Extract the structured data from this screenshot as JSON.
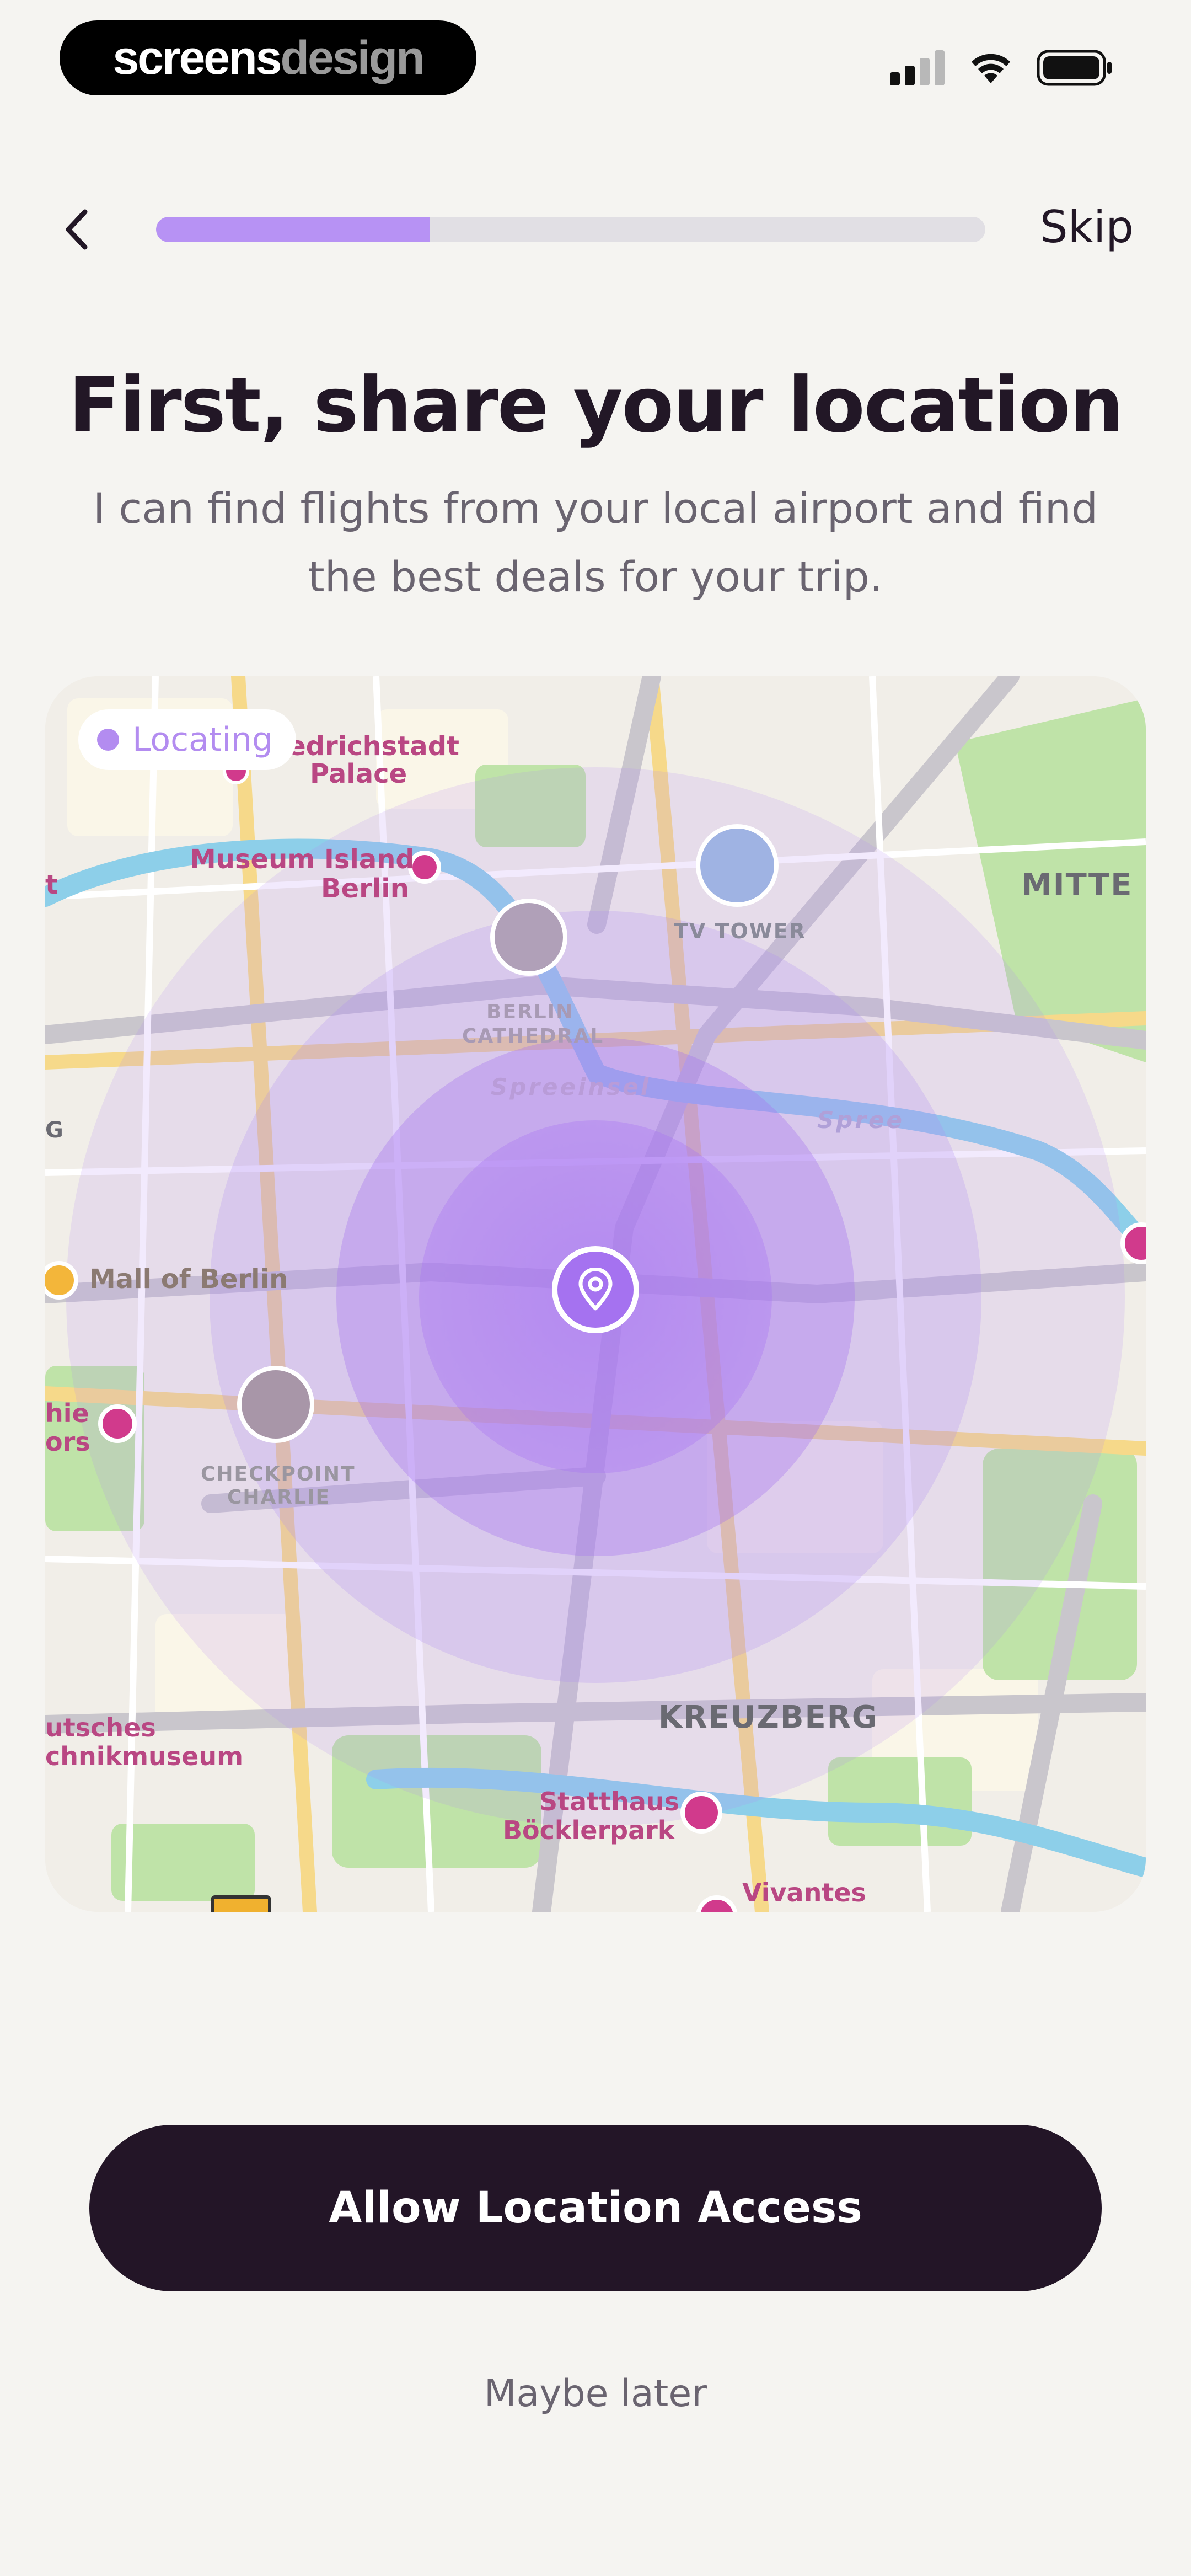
{
  "status_bar": {
    "brand_part1": "screens",
    "brand_part2": "design",
    "signal_icon": "cellular-signal-icon",
    "wifi_icon": "wifi-icon",
    "battery_icon": "battery-icon"
  },
  "nav": {
    "back_icon": "chevron-left-icon",
    "progress_fraction": 0.33,
    "skip_label": "Skip"
  },
  "header": {
    "title": "First, share your location",
    "subtitle": "I can find flights from your local airport and find the best deals for your trip."
  },
  "map": {
    "status_label": "Locating",
    "accent_color": "#a572f0",
    "labels": {
      "friedrichstadt": "riedrichstadt",
      "palace": "Palace",
      "museum_island": "Museum Island",
      "museum_island_2": "Berlin",
      "tv_tower": "TV TOWER",
      "berlin_cathedral": "BERLIN",
      "berlin_cathedral_2": "CATHEDRAL",
      "spreeinsel": "Spreeinsel",
      "spree": "Spree",
      "mitte": "MITTE",
      "mall_of_berlin": "Mall of Berlin",
      "hie": "hie",
      "ors": "ors",
      "checkpoint": "CHECKPOINT",
      "charlie": "CHARLIE",
      "kreuzberg": "KREUZBERG",
      "technikmuseum_1": "utsches",
      "technikmuseum_2": "chnikmuseum",
      "statthaus_1": "Statthaus",
      "statthaus_2": "Böcklerpark",
      "vivantes": "Vivantes",
      "g": "G",
      "t": "t"
    },
    "center_pin_icon": "location-pin-icon"
  },
  "actions": {
    "primary_label": "Allow Location Access",
    "secondary_label": "Maybe later"
  }
}
